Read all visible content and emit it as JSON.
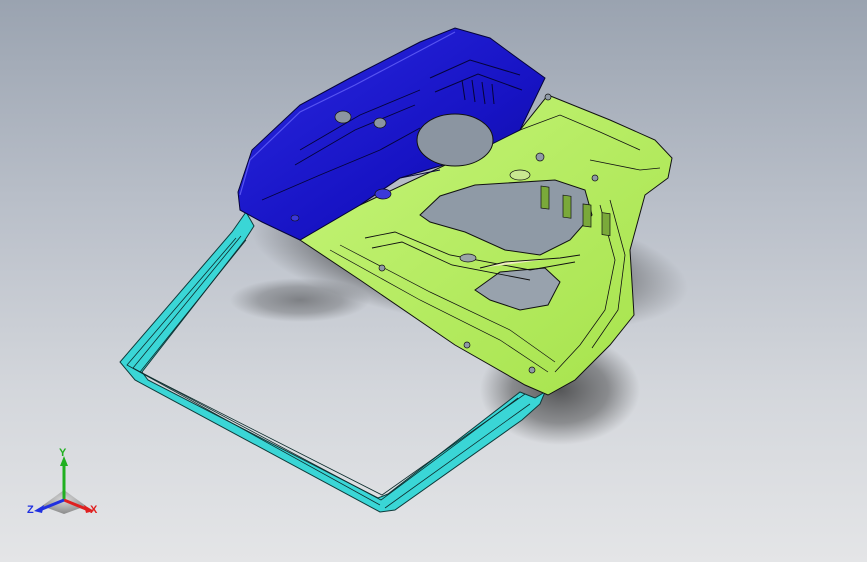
{
  "viewport": {
    "background_top": "#9aa3b0",
    "background_bottom": "#e4e5e7"
  },
  "model": {
    "description_colors": {
      "upper_panel": "#1a17c9",
      "main_panel": "#b4ec5a",
      "window_frame": "#3ad6d6",
      "edge_lines": "#111111"
    }
  },
  "triad": {
    "x_label": "X",
    "y_label": "Y",
    "z_label": "Z",
    "x_color": "#e02020",
    "y_color": "#20b020",
    "z_color": "#2030e0"
  }
}
